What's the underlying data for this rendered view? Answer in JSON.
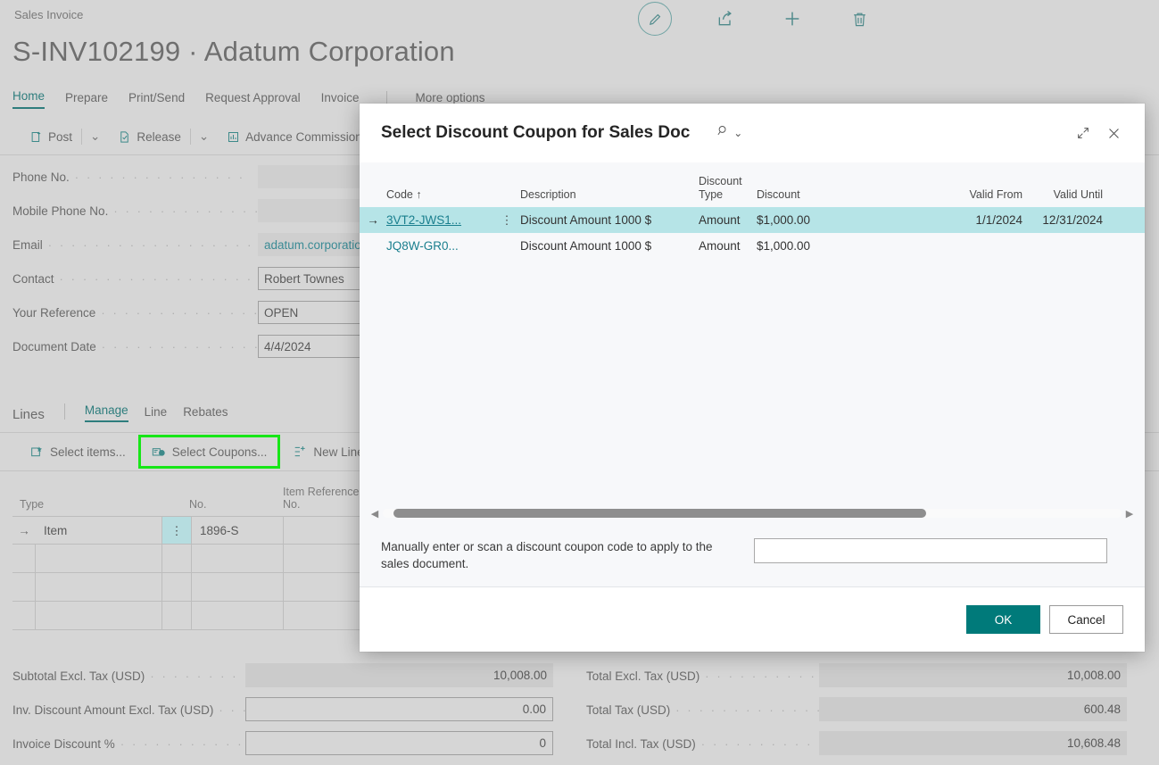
{
  "page": {
    "breadcrumb": "Sales Invoice",
    "title": "S-INV102199 · Adatum Corporation"
  },
  "top_actions": [
    {
      "name": "edit-icon",
      "label": "Edit"
    },
    {
      "name": "share-icon",
      "label": "Share"
    },
    {
      "name": "add-icon",
      "label": "New"
    },
    {
      "name": "delete-icon",
      "label": "Delete"
    }
  ],
  "tabs": [
    {
      "label": "Home",
      "active": true
    },
    {
      "label": "Prepare",
      "active": false
    },
    {
      "label": "Print/Send",
      "active": false
    },
    {
      "label": "Request Approval",
      "active": false
    },
    {
      "label": "Invoice",
      "active": false
    },
    {
      "label": "More options",
      "active": false
    }
  ],
  "ribbon": {
    "post_label": "Post",
    "release_label": "Release",
    "advance_commissions_label": "Advance Commissions",
    "caret": "⌄"
  },
  "fields": [
    {
      "label": "Phone No.",
      "value": "",
      "style": "filled"
    },
    {
      "label": "Mobile Phone No.",
      "value": "",
      "style": "filled"
    },
    {
      "label": "Email",
      "value": "adatum.corporation",
      "style": "filled-link"
    },
    {
      "label": "Contact",
      "value": "Robert Townes",
      "style": "boxed"
    },
    {
      "label": "Your Reference",
      "value": "OPEN",
      "style": "boxed"
    },
    {
      "label": "Document Date",
      "value": "4/4/2024",
      "style": "boxed"
    }
  ],
  "lines": {
    "title": "Lines",
    "tabs": [
      {
        "label": "Manage",
        "active": true
      },
      {
        "label": "Line",
        "active": false
      },
      {
        "label": "Rebates",
        "active": false
      }
    ],
    "actions": [
      {
        "label": "Select items...",
        "icon": "select-items-icon",
        "highlighted": false
      },
      {
        "label": "Select Coupons...",
        "icon": "select-coupons-icon",
        "highlighted": true
      },
      {
        "label": "New Line",
        "icon": "new-line-icon",
        "highlighted": false
      }
    ],
    "columns": [
      "Type",
      "No.",
      "Item Reference No."
    ],
    "rows": [
      {
        "type": "Item",
        "no": "1896-S",
        "item_reference_no": "",
        "selected": true
      },
      {
        "type": "",
        "no": "",
        "item_reference_no": "",
        "selected": false
      },
      {
        "type": "",
        "no": "",
        "item_reference_no": "",
        "selected": false
      },
      {
        "type": "",
        "no": "",
        "item_reference_no": "",
        "selected": false
      }
    ]
  },
  "totals_left": [
    {
      "label": "Subtotal Excl. Tax (USD)",
      "value": "10,008.00",
      "style": "filled"
    },
    {
      "label": "Inv. Discount Amount Excl. Tax (USD)",
      "value": "0.00",
      "style": "boxed"
    },
    {
      "label": "Invoice Discount %",
      "value": "0",
      "style": "boxed"
    }
  ],
  "totals_right": [
    {
      "label": "Total Excl. Tax (USD)",
      "value": "10,008.00",
      "style": "filled"
    },
    {
      "label": "Total Tax (USD)",
      "value": "600.48",
      "style": "filled"
    },
    {
      "label": "Total Incl. Tax (USD)",
      "value": "10,608.48",
      "style": "filled"
    }
  ],
  "dialog": {
    "title": "Select Discount Coupon for Sales Doc",
    "search_icon": "search-icon",
    "search_caret": "⌄",
    "expand_icon": "expand-icon",
    "close_icon": "close-icon",
    "columns": [
      {
        "label": "Code ↑"
      },
      {
        "label": "Description"
      },
      {
        "label": "Discount\nType"
      },
      {
        "label": "Discount"
      },
      {
        "label": "Valid From"
      },
      {
        "label": "Valid Until"
      }
    ],
    "rows": [
      {
        "code": "3VT2-JWS1...",
        "description": "Discount Amount 1000 $",
        "discount_type": "Amount",
        "discount": "$1,000.00",
        "valid_from": "1/1/2024",
        "valid_until": "12/31/2024",
        "selected": true
      },
      {
        "code": "JQ8W-GR0...",
        "description": "Discount Amount 1000 $",
        "discount_type": "Amount",
        "discount": "$1,000.00",
        "valid_from": "",
        "valid_until": "",
        "selected": false
      }
    ],
    "manual_text": "Manually enter or scan a discount coupon code to apply to the sales document.",
    "manual_value": "",
    "manual_placeholder": "",
    "ok_label": "OK",
    "cancel_label": "Cancel"
  },
  "colors": {
    "accent_teal": "#007a7a",
    "link_teal": "#1a7f8e",
    "row_selected": "#b6e4e7",
    "highlight_green": "#17e617",
    "page_bg": "#d6d6d6"
  }
}
